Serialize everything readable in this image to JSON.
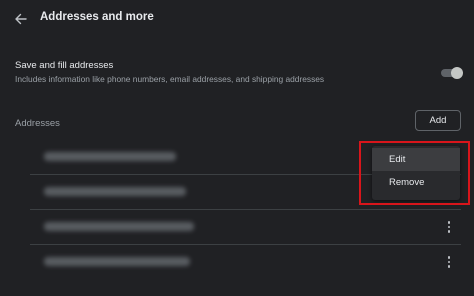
{
  "header": {
    "title": "Addresses and more",
    "back_icon": "arrow-left-icon"
  },
  "save_fill": {
    "title": "Save and fill addresses",
    "description": "Includes information like phone numbers, email addresses, and shipping addresses",
    "enabled": true
  },
  "addresses": {
    "section_label": "Addresses",
    "add_label": "Add",
    "items": [
      {
        "obscured": true,
        "has_menu_button": false
      },
      {
        "obscured": true,
        "has_menu_button": false
      },
      {
        "obscured": true,
        "has_menu_button": true
      },
      {
        "obscured": true,
        "has_menu_button": true
      }
    ]
  },
  "context_menu": {
    "items": [
      {
        "label": "Edit",
        "hovered": true
      },
      {
        "label": "Remove",
        "hovered": false
      }
    ]
  },
  "colors": {
    "background": "#202124",
    "text_primary": "#e8eaed",
    "text_secondary": "#9aa0a6",
    "highlight_box": "#d8151b"
  }
}
